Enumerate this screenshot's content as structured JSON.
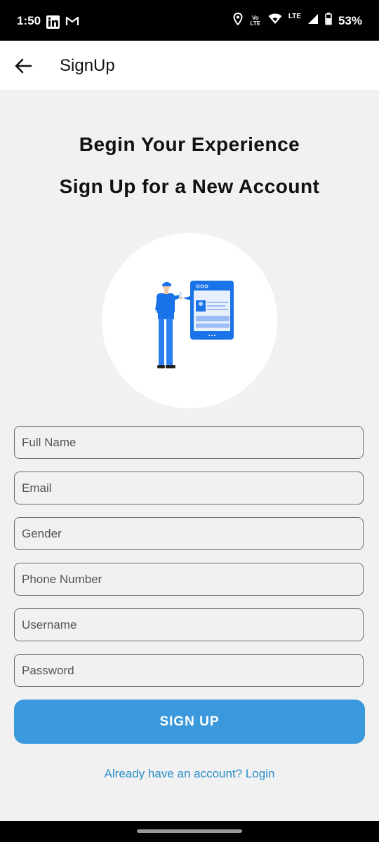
{
  "status_bar": {
    "time": "1:50",
    "network_label": "LTE",
    "volte_label": "Vo LTE",
    "battery": "53%"
  },
  "app_bar": {
    "title": "SignUp"
  },
  "headings": {
    "line1": "Begin Your Experience",
    "line2": "Sign Up for a New Account"
  },
  "form": {
    "fields": [
      {
        "placeholder": "Full Name",
        "value": ""
      },
      {
        "placeholder": "Email",
        "value": ""
      },
      {
        "placeholder": "Gender",
        "value": ""
      },
      {
        "placeholder": "Phone Number",
        "value": ""
      },
      {
        "placeholder": "Username",
        "value": ""
      },
      {
        "placeholder": "Password",
        "value": ""
      }
    ],
    "submit_label": "SIGN UP",
    "login_text": "Already have an account? Login"
  },
  "colors": {
    "primary": "#3a98dc",
    "link": "#2a8ec9",
    "background": "#f1f1f1",
    "illustration_blue": "#1a73e8"
  },
  "icons": {
    "back": "arrow-left-icon",
    "linkedin": "linkedin-icon",
    "gmail": "gmail-icon",
    "location": "location-pin-icon",
    "wifi": "wifi-icon",
    "signal": "signal-icon",
    "battery": "battery-icon"
  }
}
